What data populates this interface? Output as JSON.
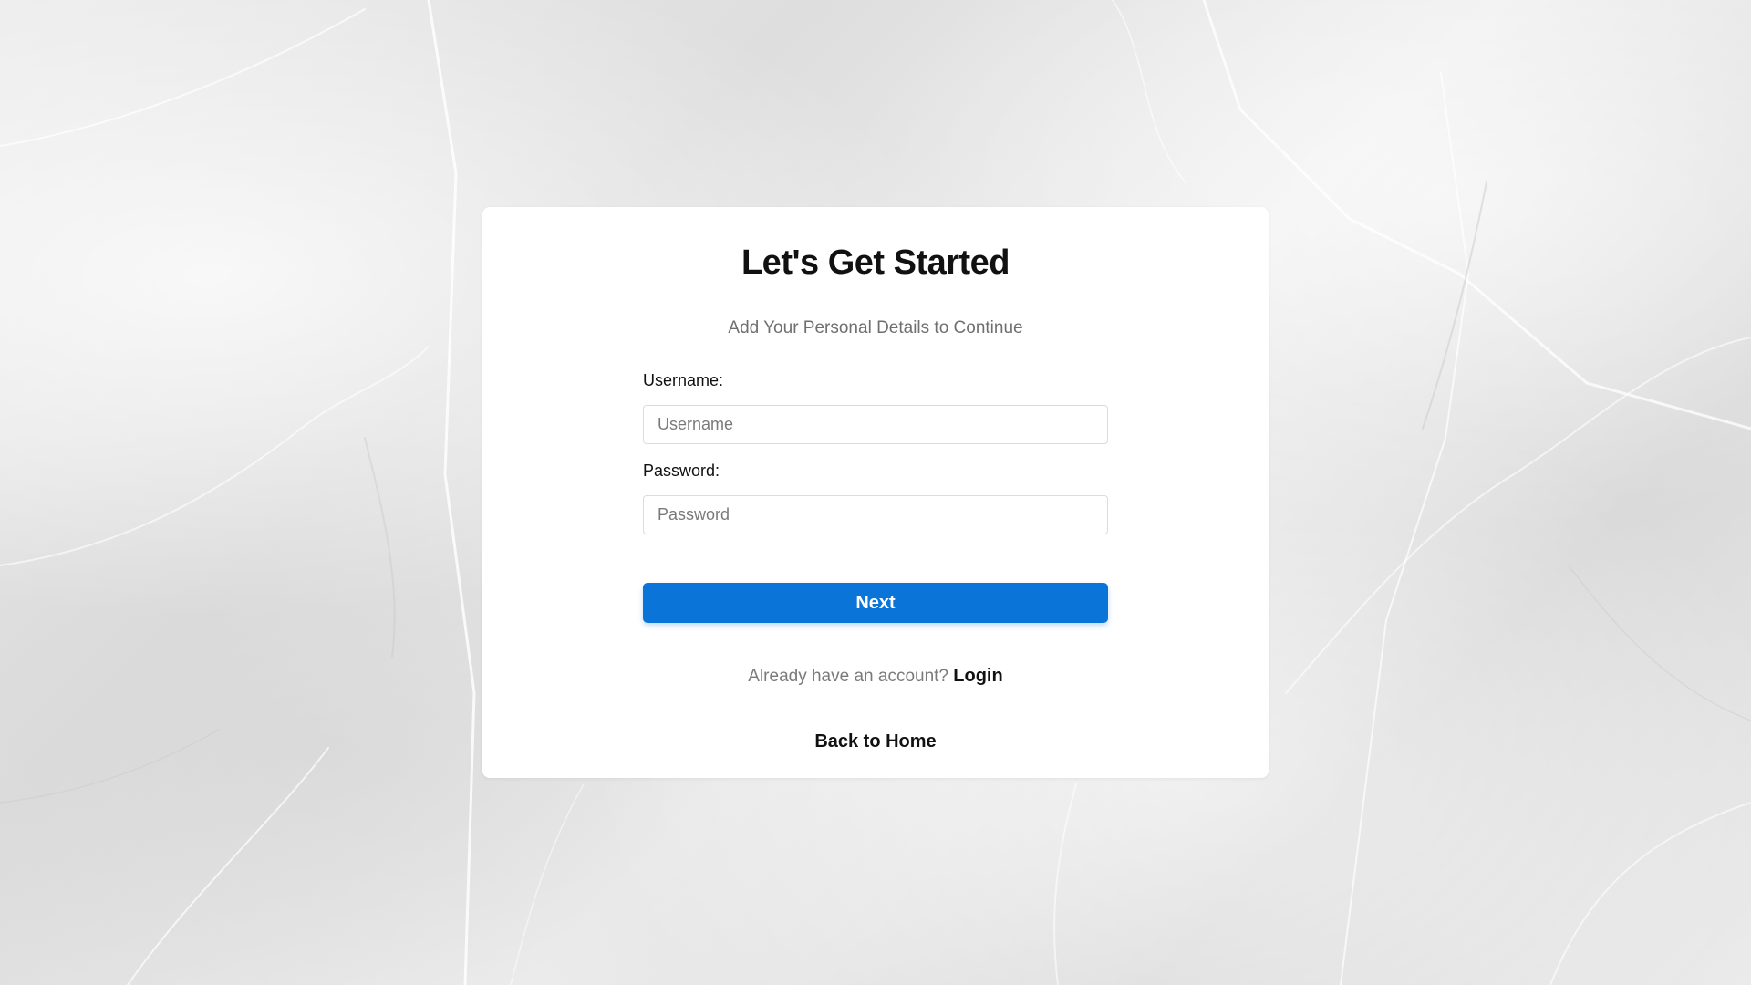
{
  "form": {
    "title": "Let's Get Started",
    "subtitle": "Add Your Personal Details to Continue",
    "username_label": "Username:",
    "username_placeholder": "Username",
    "username_value": "",
    "password_label": "Password:",
    "password_placeholder": "Password",
    "password_value": "",
    "next_label": "Next",
    "login_prompt": "Already have an account?",
    "login_link": "Login",
    "home_link": "Back to Home"
  },
  "colors": {
    "accent": "#0b74d9",
    "card_background": "#ffffff",
    "page_background": "#e6e6e6",
    "subtle_text": "#6f6f6f"
  }
}
